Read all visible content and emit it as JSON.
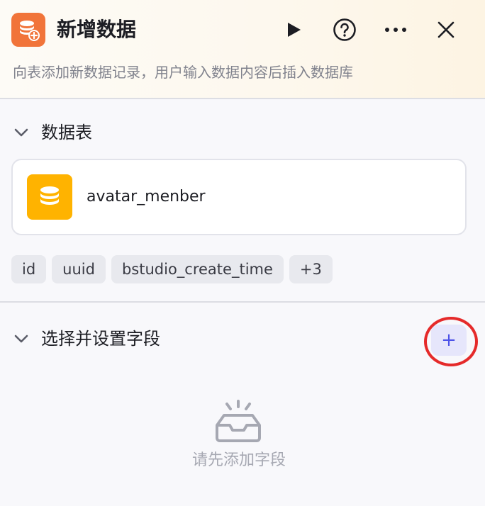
{
  "header": {
    "title": "新增数据",
    "subtitle": "向表添加新数据记录，用户输入数据内容后插入数据库",
    "icons": {
      "node": "database-add-icon",
      "run": "play-icon",
      "help": "help-circle-icon",
      "more": "more-horizontal-icon",
      "close": "close-icon"
    },
    "accent_color": "#f1743a"
  },
  "data_table_section": {
    "title": "数据表",
    "table": {
      "name": "avatar_menber",
      "icon": "database-icon",
      "icon_color": "#ffb300"
    },
    "field_tags": [
      "id",
      "uuid",
      "bstudio_create_time",
      "+3"
    ]
  },
  "fields_section": {
    "title": "选择并设置字段",
    "add_button_label": "+",
    "highlight_color": "#e52a2a",
    "empty_state": {
      "icon": "empty-inbox-icon",
      "text": "请先添加字段"
    }
  }
}
